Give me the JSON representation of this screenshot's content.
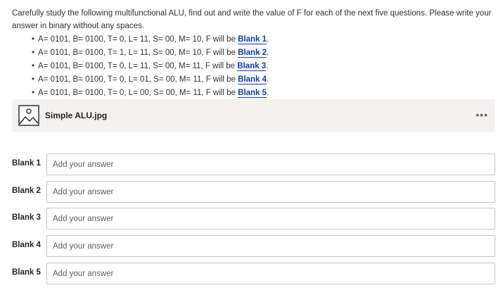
{
  "question": {
    "text": "Carefully study the following multifunctional ALU, find out and write the value of F for each of the next five questions. Please write your answer in binary without any spaces.",
    "items": [
      {
        "bullet": "•",
        "text": "A= 0101, B= 0100, T= 0, L= 11, S= 00, M= 10, F will be ",
        "blank": "Blank 1",
        "end": "."
      },
      {
        "bullet": "•",
        "text": "A= 0101, B= 0100, T= 1, L= 11, S= 00, M= 10, F will be ",
        "blank": "Blank 2",
        "end": "."
      },
      {
        "bullet": "•",
        "text": "A= 0101, B= 0100, T= 0, L= 11, S= 00, M= 11, F will be ",
        "blank": "Blank 3",
        "end": "."
      },
      {
        "bullet": "•",
        "text": "A= 0101, B= 0100, T= 0, L= 01, S= 00, M= 11, F will be ",
        "blank": "Blank 4",
        "end": "."
      },
      {
        "bullet": "•",
        "text": "A= 0101, B= 0100, T= 0, L= 00, S= 00, M= 11, F will be ",
        "blank": "Blank 5",
        "end": "."
      }
    ]
  },
  "attachment": {
    "filename": "Simple ALU.jpg",
    "icon": "image-file-icon",
    "more_label": "•••"
  },
  "answers": [
    {
      "label": "Blank 1",
      "value": "",
      "placeholder": "Add your answer"
    },
    {
      "label": "Blank 2",
      "value": "",
      "placeholder": "Add your answer"
    },
    {
      "label": "Blank 3",
      "value": "",
      "placeholder": "Add your answer"
    },
    {
      "label": "Blank 4",
      "value": "",
      "placeholder": "Add your answer"
    },
    {
      "label": "Blank 5",
      "value": "",
      "placeholder": "Add your answer"
    }
  ],
  "colors": {
    "blank_link": "#0f3ea8",
    "attachment_bg": "#f3f2f1",
    "input_border": "#c8c6c4"
  }
}
